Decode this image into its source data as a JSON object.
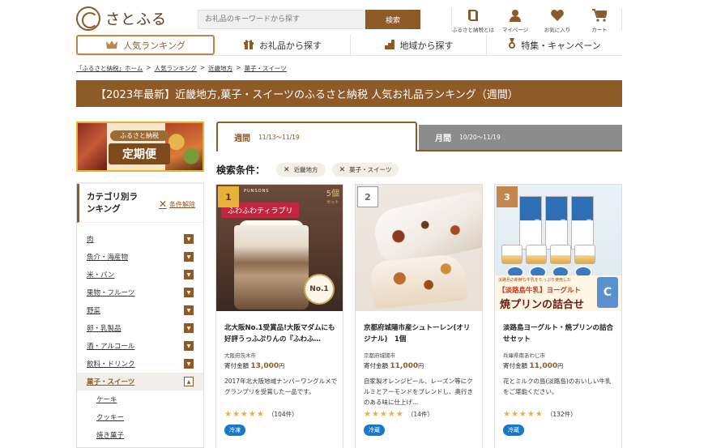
{
  "header": {
    "logo_text": "さとふる",
    "search_placeholder": "お礼品のキーワードから探す",
    "search_button": "検索",
    "utils": [
      {
        "icon": "book-icon",
        "label": "ふるさと納税とは"
      },
      {
        "icon": "user-icon",
        "label": "マイページ"
      },
      {
        "icon": "heart-icon",
        "label": "お気に入り"
      },
      {
        "icon": "cart-icon",
        "label": "カート"
      }
    ]
  },
  "nav": {
    "items": [
      {
        "icon": "crown-icon",
        "label": "人気ランキング",
        "active": true
      },
      {
        "icon": "gift-icon",
        "label": "お礼品から探す"
      },
      {
        "icon": "region-icon",
        "label": "地域から探す"
      },
      {
        "icon": "medal-icon",
        "label": "特集・キャンペーン"
      }
    ]
  },
  "breadcrumb": [
    "「ふるさと納税」ホーム",
    "人気ランキング",
    "近畿地方",
    "菓子・スイーツ"
  ],
  "breadcrumb_sep": ">",
  "page_title": "【2023年最新】近畿地方,菓子・スイーツのふるさと納税 人気お礼品ランキング（週間）",
  "sidebar": {
    "banner": {
      "line1": "ふるさと納税",
      "line2": "定期便"
    },
    "category_title": "カテゴリ別ランキング",
    "clear_label": "条件解除",
    "categories": [
      {
        "label": "肉"
      },
      {
        "label": "魚介・海産物"
      },
      {
        "label": "米・パン"
      },
      {
        "label": "果物・フルーツ"
      },
      {
        "label": "野菜"
      },
      {
        "label": "卵・乳製品"
      },
      {
        "label": "酒・アルコール"
      },
      {
        "label": "飲料・ドリンク"
      },
      {
        "label": "菓子・スイーツ",
        "active": true
      }
    ],
    "subcategories": [
      "ケーキ",
      "クッキー",
      "焼き菓子"
    ]
  },
  "tabs": {
    "week": {
      "label": "週間",
      "range": "11/13〜11/19"
    },
    "month": {
      "label": "月間",
      "range": "10/20〜11/19"
    }
  },
  "conditions": {
    "label": "検索条件：",
    "chips": [
      "近畿地方",
      "菓子・スイーツ"
    ]
  },
  "products": [
    {
      "rank": "1",
      "image_texts": {
        "brand": "PUNSONS",
        "ribbon": "ふわふわティラプリ",
        "pack": "5個",
        "pack_sub": "セット",
        "badge": "No.1"
      },
      "name": "北大阪No.1受賞品!大阪マダムにも好評うっふぷりんの『ふわふ…",
      "location": "大阪府茨木市",
      "price_label": "寄付金額",
      "price": "13,000",
      "price_unit": "円",
      "description": "2017年北大阪地域ナンバーワングルメでグランプリを受賞した一品です。",
      "rating": 5,
      "reviews": "（104件）",
      "temperature": "冷凍"
    },
    {
      "rank": "2",
      "name": "京都府城陽市産シュトーレン(オリジナル)　1個",
      "location": "京都府城陽市",
      "price_label": "寄付金額",
      "price": "11,000",
      "price_unit": "円",
      "description": "自家製オレンジピール、レーズン等にクルミとアーモンドをブレンドし、奥行きのある味に仕上げ…",
      "rating": 5,
      "reviews": "（14件）",
      "temperature": "冷蔵"
    },
    {
      "rank": "3",
      "image_texts": {
        "box": "淡路",
        "small": "淡路島の新鮮な牛乳をたっぷり使用した",
        "mid": "【淡路島牛乳】ヨーグルト",
        "large": "焼プリンの詰合せ",
        "set": "C"
      },
      "name": "淡路島ヨーグルト・焼プリンの詰合せセット",
      "location": "兵庫県南あわじ市",
      "price_label": "寄付金額",
      "price": "11,000",
      "price_unit": "円",
      "description": "花とミルクの島(淡路島)のおいしい牛乳をご堪能ください。",
      "rating": 5,
      "reviews": "（132件）",
      "temperature": "冷蔵"
    }
  ],
  "colors": {
    "brand": "#8d5a28",
    "accent_gold": "#e7b23c",
    "temp_badge": "#1779c9",
    "tab_inactive": "#8c8c8c"
  }
}
